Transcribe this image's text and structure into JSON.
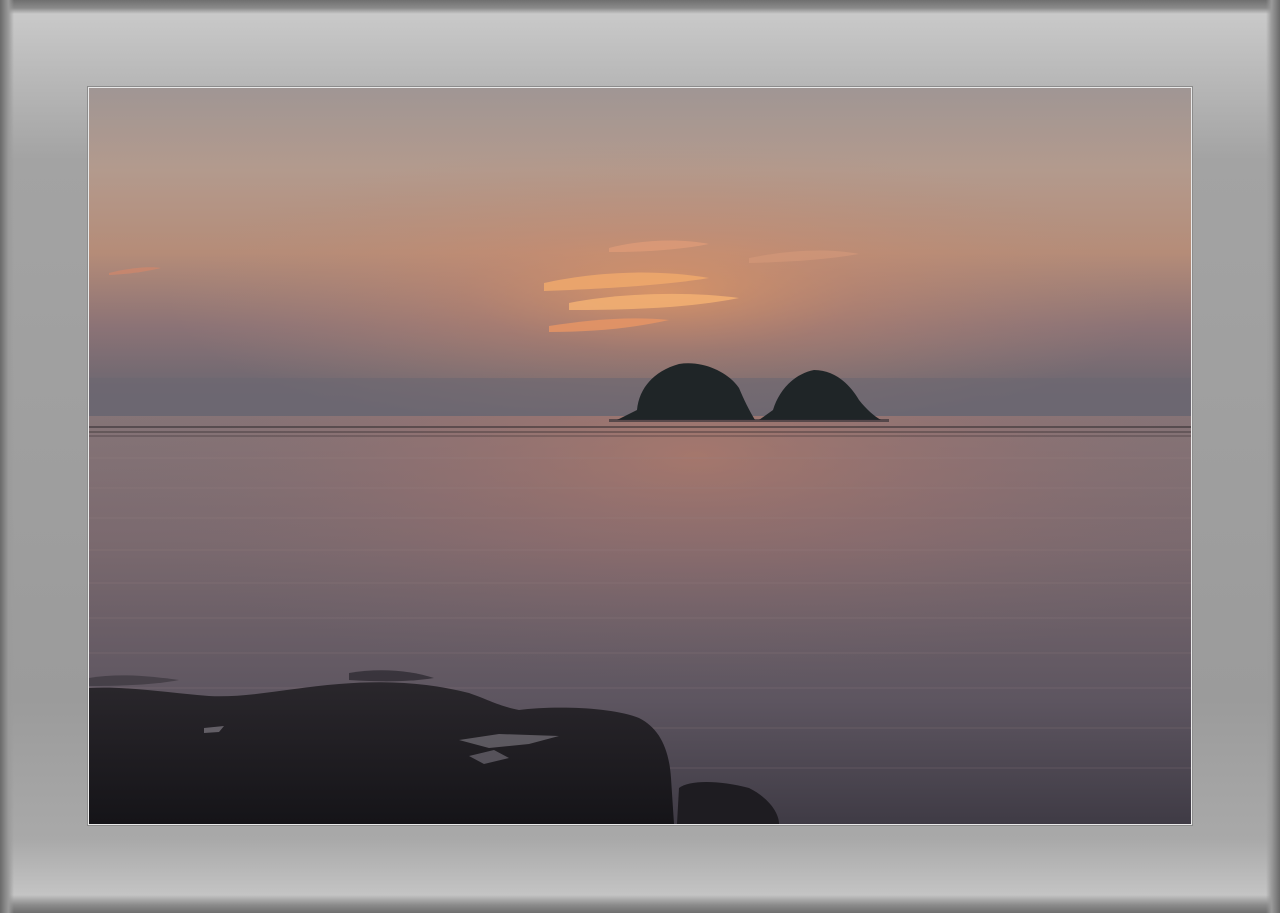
{
  "image": {
    "description_name": "sunset-sea-with-two-islets",
    "colors": {
      "frame": "#a3a3a3",
      "sky_top": "#9b8f8c",
      "sky_glow": "#d89a6e",
      "sky_horizon": "#6e6670",
      "sea": "#7a6d70",
      "island": "#1e2426",
      "rocks": "#1c1b1f"
    }
  }
}
